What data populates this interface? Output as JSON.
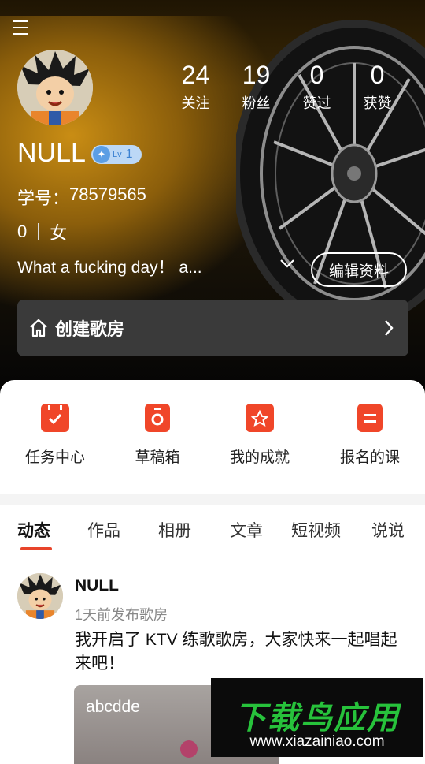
{
  "profile": {
    "username": "NULL",
    "level_label": "Lv",
    "level_value": "1",
    "student_id_label": "学号：",
    "student_id": "78579565",
    "age": "0",
    "gender": "女",
    "bio": "What a fucking day！ a...",
    "edit_label": "编辑资料"
  },
  "stats": [
    {
      "value": "24",
      "label": "关注"
    },
    {
      "value": "19",
      "label": "粉丝"
    },
    {
      "value": "0",
      "label": "赞过"
    },
    {
      "value": "0",
      "label": "获赞"
    }
  ],
  "room": {
    "label": "创建歌房"
  },
  "shortcuts": [
    {
      "label": "任务中心",
      "icon": "calendar-check-icon"
    },
    {
      "label": "草稿箱",
      "icon": "draft-box-icon"
    },
    {
      "label": "我的成就",
      "icon": "achievement-icon"
    },
    {
      "label": "报名的课",
      "icon": "course-list-icon"
    }
  ],
  "tabs": [
    "动态",
    "作品",
    "相册",
    "文章",
    "短视频",
    "说说"
  ],
  "active_tab": "动态",
  "post": {
    "author": "NULL",
    "time": "1天前发布歌房",
    "text": "我开启了 KTV 练歌歌房，大家快来一起唱起来吧！",
    "card_title": "abcdde"
  },
  "watermark": {
    "logo_text": "下载鸟应用",
    "url": "www.xiazainiao.com"
  },
  "colors": {
    "accent": "#f04629",
    "tab_indicator": "#e8442a",
    "room_bar": "#3a3a3a",
    "logo_green": "#27c23b"
  }
}
